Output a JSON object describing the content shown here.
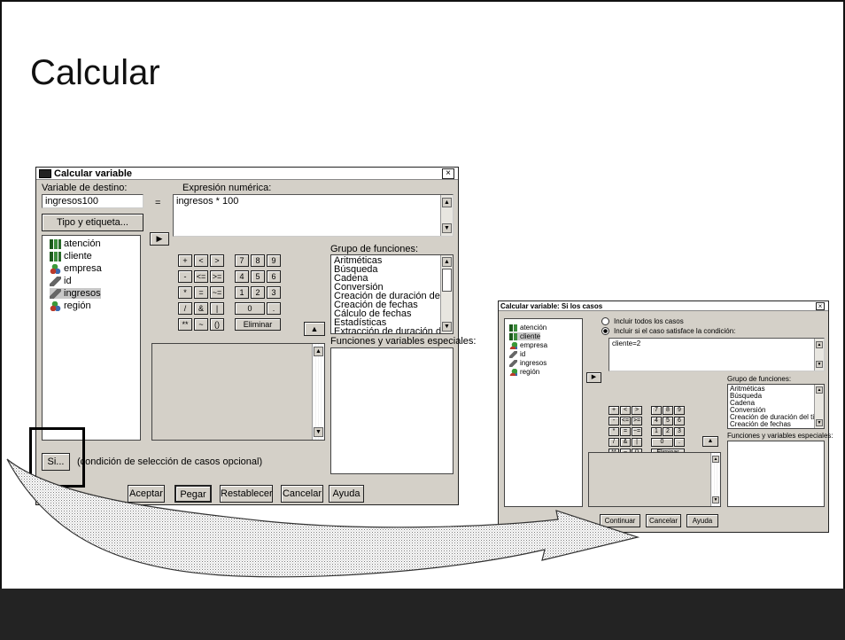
{
  "slide": {
    "title": "Calcular"
  },
  "main_dialog": {
    "title": "Calcular variable",
    "close": "×",
    "target_label": "Variable de destino:",
    "target_value": "ingresos100",
    "equals": "=",
    "expression_label": "Expresión numérica:",
    "expression_value": "ingresos * 100",
    "type_button": "Tipo y etiqueta...",
    "variables": [
      "atención",
      "cliente",
      "empresa",
      "id",
      "ingresos",
      "región"
    ],
    "keypad": [
      "+",
      "<",
      ">",
      "7",
      "8",
      "9",
      "-",
      "<=",
      ">=",
      "4",
      "5",
      "6",
      "*",
      "=",
      "~=",
      "1",
      "2",
      "3",
      "/",
      "&",
      "|",
      "0",
      ".",
      "**",
      "~",
      "()"
    ],
    "delete_button": "Eliminar",
    "function_group_label": "Grupo de funciones:",
    "function_groups": [
      "Aritméticas",
      "Búsqueda",
      "Cadena",
      "Conversión",
      "Creación de duración del tier",
      "Creación de fechas",
      "Cálculo de fechas",
      "Estadísticas",
      "Extracción de duración del ti"
    ],
    "special_functions_label": "Funciones y variables especiales:",
    "if_button": "Si...",
    "if_caption": "(condición de selección de casos opcional)",
    "buttons": [
      "Aceptar",
      "Pegar",
      "Restablecer",
      "Cancelar",
      "Ayuda"
    ]
  },
  "if_dialog": {
    "title": "Calcular variable: Si los casos",
    "close": "×",
    "radio_all": "Incluir todos los casos",
    "radio_condition": "Incluir si el caso satisface la condición:",
    "condition_value": "cliente=2",
    "variables": [
      "atención",
      "cliente",
      "empresa",
      "id",
      "ingresos",
      "región"
    ],
    "function_group_label": "Grupo de funciones:",
    "function_groups": [
      "Aritméticas",
      "Búsqueda",
      "Cadena",
      "Conversión",
      "Creación de duración del tier",
      "Creación de fechas"
    ],
    "special_functions_label": "Funciones y variables especiales:",
    "delete_button": "Eliminar",
    "buttons": [
      "Continuar",
      "Cancelar",
      "Ayuda"
    ]
  }
}
